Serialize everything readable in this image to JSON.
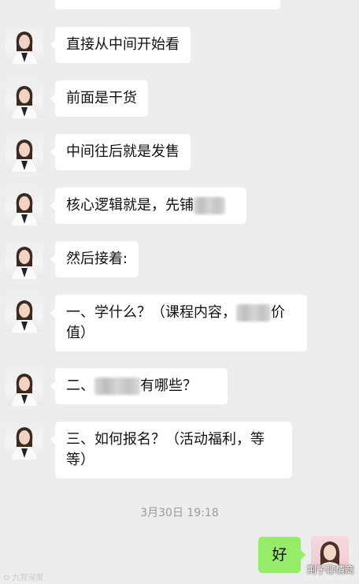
{
  "messages": [
    {
      "text": "直接从中间开始看"
    },
    {
      "text": "前面是干货"
    },
    {
      "text": "中间往后就是发售"
    },
    {
      "text_a": "核心逻辑就是，先铺"
    },
    {
      "text": "然后接着:"
    },
    {
      "text_a": "一、学什么？（课程内容，",
      "text_b": "价",
      "text_c": "值）"
    },
    {
      "text_a": "二、",
      "text_b": "有哪些？"
    },
    {
      "text": "三、如何报名？（活动福利，等等）"
    }
  ],
  "timestamp": "3月30日 19:18",
  "my_message": "好",
  "watermark_left": "⊙ 九宫深度",
  "watermark_right": "荆子聊情商",
  "colors": {
    "background": "#ededed",
    "bubble_received": "#ffffff",
    "bubble_sent": "#95ec69"
  }
}
